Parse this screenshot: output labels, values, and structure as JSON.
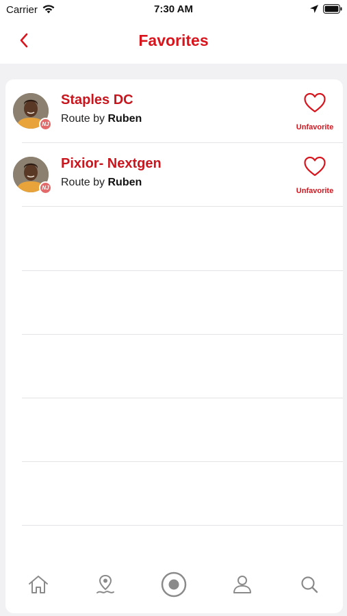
{
  "status_bar": {
    "carrier": "Carrier",
    "time": "7:30 AM"
  },
  "nav": {
    "title": "Favorites",
    "back_icon": "chevron-left-icon"
  },
  "colors": {
    "accent": "#d8141d",
    "tab_icon": "#8a8a8a",
    "background": "#f1f1f4"
  },
  "favorites": [
    {
      "title": "Staples DC",
      "route_by_prefix": "Route by",
      "author": "Ruben",
      "badge": "NJ",
      "action_label": "Unfavorite",
      "action_icon": "heart-outline-icon"
    },
    {
      "title": "Pixior- Nextgen",
      "route_by_prefix": "Route by",
      "author": "Ruben",
      "badge": "NJ",
      "action_label": "Unfavorite",
      "action_icon": "heart-outline-icon"
    }
  ],
  "tab_bar": {
    "tabs": [
      {
        "icon": "home-icon"
      },
      {
        "icon": "map-pin-route-icon"
      },
      {
        "icon": "record-icon"
      },
      {
        "icon": "profile-icon"
      },
      {
        "icon": "search-icon"
      }
    ]
  }
}
